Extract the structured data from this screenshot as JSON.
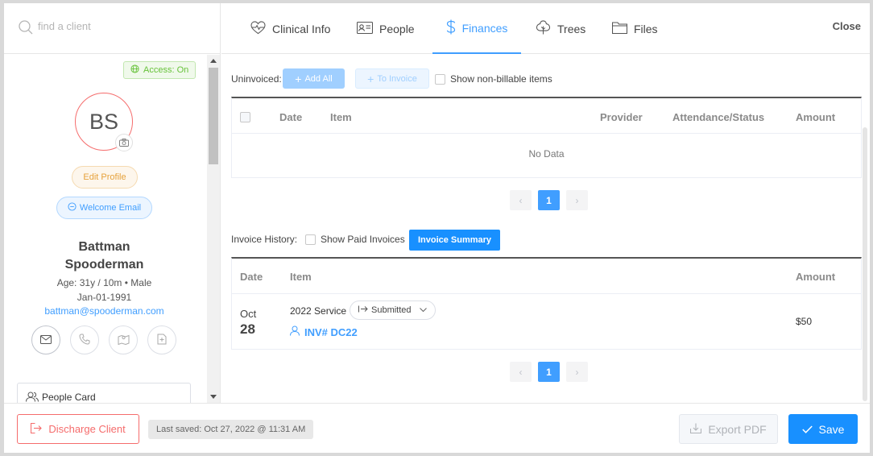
{
  "search": {
    "placeholder": "find a client"
  },
  "profile": {
    "access_label": "Access: On",
    "initials": "BS",
    "edit_profile": "Edit Profile",
    "welcome_email": "Welcome Email",
    "first_name": "Battman",
    "last_name": "Spooderman",
    "age_sex": "Age: 31y / 10m • Male",
    "dob": "Jan-01-1991",
    "email": "battman@spooderman.com",
    "people_card": "People Card"
  },
  "tabs": [
    {
      "label": "Clinical Info",
      "icon": "heartbeat-icon",
      "active": false
    },
    {
      "label": "People",
      "icon": "id-card-icon",
      "active": false
    },
    {
      "label": "Finances",
      "icon": "dollar-icon",
      "active": true
    },
    {
      "label": "Trees",
      "icon": "tree-icon",
      "active": false
    },
    {
      "label": "Files",
      "icon": "folder-icon",
      "active": false
    }
  ],
  "close_label": "Close",
  "uninvoiced": {
    "label": "Uninvoiced:",
    "add_all": "Add All",
    "to_invoice": "To Invoice",
    "show_nonbillable": "Show non-billable items",
    "columns": [
      "Date",
      "Item",
      "Provider",
      "Attendance/Status",
      "Amount"
    ],
    "empty_text": "No Data",
    "page": "1"
  },
  "history": {
    "label": "Invoice History:",
    "show_paid": "Show Paid Invoices",
    "summary_button": "Invoice Summary",
    "columns": [
      "Date",
      "Item",
      "Amount"
    ],
    "rows": [
      {
        "month": "Oct",
        "day": "28",
        "item": "2022 Service",
        "status": "Submitted",
        "invoice": "INV# DC22",
        "amount": "$50"
      }
    ],
    "page": "1"
  },
  "footer": {
    "discharge": "Discharge Client",
    "last_saved": "Last saved: Oct 27, 2022 @ 11:31 AM",
    "export_pdf": "Export PDF",
    "save": "Save"
  },
  "colors": {
    "primary": "#1890ff",
    "link": "#409eff",
    "danger": "#f56c6c",
    "success": "#67c23a",
    "warning": "#e6a23c"
  }
}
